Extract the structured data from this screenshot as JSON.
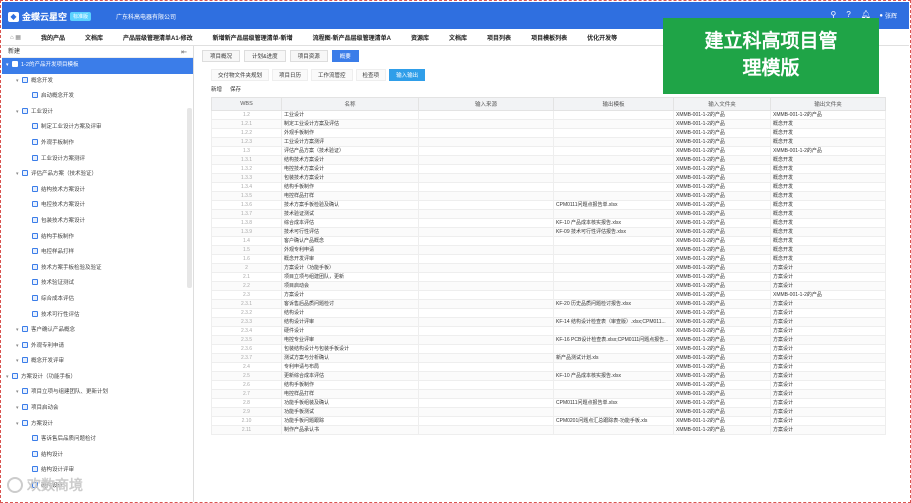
{
  "topbar": {
    "logo_text": "金蝶云星空",
    "logo_badge": "标准版",
    "company": "广东科高电器有限公司",
    "icons": [
      "search-icon",
      "help-icon",
      "bell-icon",
      "user-icon"
    ],
    "user_name": "张辉"
  },
  "menu": {
    "items": [
      "我的产品",
      "文档库",
      "产品层级管理清单A1-修改",
      "新增新产品层级管理清单-新增",
      "流程图-新产品层级管理清单A",
      "资源库",
      "文档库",
      "项目列表",
      "项目模板列表",
      "优化开发等"
    ]
  },
  "sidebar": {
    "header": "新建",
    "items": [
      {
        "label": "1-2的产品开发项目模板",
        "level": 0,
        "selected": true
      },
      {
        "label": "概念开发",
        "level": 1
      },
      {
        "label": "启动概念开发",
        "level": 2
      },
      {
        "label": "工业设计",
        "level": 1
      },
      {
        "label": "制定工业设计方案及评审",
        "level": 2
      },
      {
        "label": "外观手板制作",
        "level": 2
      },
      {
        "label": "工业设计方案测评",
        "level": 2
      },
      {
        "label": "评估产品方案（技术验证）",
        "level": 1
      },
      {
        "label": "结构技术方案设计",
        "level": 2
      },
      {
        "label": "电控技术方案设计",
        "level": 2
      },
      {
        "label": "包装技术方案设计",
        "level": 2
      },
      {
        "label": "结构手板制作",
        "level": 2
      },
      {
        "label": "电控样品打样",
        "level": 2
      },
      {
        "label": "技术方案手板检验及验证",
        "level": 2
      },
      {
        "label": "技术验证测试",
        "level": 2
      },
      {
        "label": "综合成本评估",
        "level": 2
      },
      {
        "label": "技术可行性评估",
        "level": 2
      },
      {
        "label": "客户确认产品概念",
        "level": 1
      },
      {
        "label": "外观专利申请",
        "level": 1
      },
      {
        "label": "概念开发评审",
        "level": 1
      },
      {
        "label": "方案设计（功能手板）",
        "level": 0
      },
      {
        "label": "项目立项与组建团队、更新计划",
        "level": 1
      },
      {
        "label": "项目启动会",
        "level": 1
      },
      {
        "label": "方案设计",
        "level": 1
      },
      {
        "label": "客诉售后品质问题检讨",
        "level": 2
      },
      {
        "label": "结构设计",
        "level": 2
      },
      {
        "label": "结构设计评审",
        "level": 2
      },
      {
        "label": "硬件设计",
        "level": 2
      }
    ]
  },
  "tabs": {
    "primary": [
      "项目概况",
      "计划&进度",
      "项目资源",
      "概要"
    ],
    "primary_active": 3,
    "secondary": [
      "交付物文件夹规划",
      "项目日历",
      "工作流管控",
      "检查项",
      "输入输出"
    ],
    "secondary_active": 4
  },
  "actions": [
    "新增",
    "保存"
  ],
  "grid": {
    "headers": [
      "WBS",
      "名称",
      "输入来源",
      "输出模板",
      "输入文件夹",
      "输出文件夹"
    ],
    "rows": [
      [
        "1.2",
        "工业设计",
        "",
        "",
        "XMMB-001-1-2的产品",
        "XMMB-001-1-2的产品"
      ],
      [
        "1.2.1",
        "制定工业设计方案及评估",
        "",
        "",
        "XMMB-001-1-2的产品",
        "概念开发"
      ],
      [
        "1.2.2",
        "外观手板制作",
        "",
        "",
        "XMMB-001-1-2的产品",
        "概念开发"
      ],
      [
        "1.2.3",
        "工业设计方案测评",
        "",
        "",
        "XMMB-001-1-2的产品",
        "概念开发"
      ],
      [
        "1.3",
        "评估产品方案（技术验证）",
        "",
        "",
        "XMMB-001-1-2的产品",
        "XMMB-001-1-2的产品"
      ],
      [
        "1.3.1",
        "结构技术方案设计",
        "",
        "",
        "XMMB-001-1-2的产品",
        "概念开发"
      ],
      [
        "1.3.2",
        "电控技术方案设计",
        "",
        "",
        "XMMB-001-1-2的产品",
        "概念开发"
      ],
      [
        "1.3.3",
        "包装技术方案设计",
        "",
        "",
        "XMMB-001-1-2的产品",
        "概念开发"
      ],
      [
        "1.3.4",
        "结构手板制作",
        "",
        "",
        "XMMB-001-1-2的产品",
        "概念开发"
      ],
      [
        "1.3.5",
        "电控样品打样",
        "",
        "",
        "XMMB-001-1-2的产品",
        "概念开发"
      ],
      [
        "1.3.6",
        "技术方案手板检验及确认",
        "",
        "CPM0111问题点报告单.xlsx",
        "XMMB-001-1-2的产品",
        "概念开发"
      ],
      [
        "1.3.7",
        "技术验证测试",
        "",
        "",
        "XMMB-001-1-2的产品",
        "概念开发"
      ],
      [
        "1.3.8",
        "综合成本评估",
        "",
        "KF-10 产品成本核实报告.xlsx",
        "XMMB-001-1-2的产品",
        "概念开发"
      ],
      [
        "1.3.9",
        "技术可行性评估",
        "",
        "KF-09 技术可行性评估报告.xlsx",
        "XMMB-001-1-2的产品",
        "概念开发"
      ],
      [
        "1.4",
        "客户确认产品概念",
        "",
        "",
        "XMMB-001-1-2的产品",
        "概念开发"
      ],
      [
        "1.5",
        "外观专利申请",
        "",
        "",
        "XMMB-001-1-2的产品",
        "概念开发"
      ],
      [
        "1.6",
        "概念开发评审",
        "",
        "",
        "XMMB-001-1-2的产品",
        "概念开发"
      ],
      [
        "2",
        "方案设计（功能手板）",
        "",
        "",
        "XMMB-001-1-2的产品",
        "方案设计"
      ],
      [
        "2.1",
        "项目立项与组建团队，更新",
        "",
        "",
        "XMMB-001-1-2的产品",
        "方案设计"
      ],
      [
        "2.2",
        "项目启动会",
        "",
        "",
        "XMMB-001-1-2的产品",
        "方案设计"
      ],
      [
        "2.3",
        "方案设计",
        "",
        "",
        "XMMB-001-1-2的产品",
        "XMMB-001-1-2的产品"
      ],
      [
        "2.3.1",
        "客诉售后品质问题检讨",
        "",
        "KF-20 历史品质问题检讨报告.xlsx",
        "XMMB-001-1-2的产品",
        "方案设计"
      ],
      [
        "2.3.2",
        "结构设计",
        "",
        "",
        "XMMB-001-1-2的产品",
        "方案设计"
      ],
      [
        "2.3.3",
        "结构设计评审",
        "",
        "KF-14 结构设计检查表（审查版）.xlsx;CPM011...",
        "XMMB-001-1-2的产品",
        "方案设计"
      ],
      [
        "2.3.4",
        "硬件设计",
        "",
        "",
        "XMMB-001-1-2的产品",
        "方案设计"
      ],
      [
        "2.3.5",
        "电控专业评审",
        "",
        "KF-16 PCB设计检查表.xlsx;CPM0111问题点报告...",
        "XMMB-001-1-2的产品",
        "方案设计"
      ],
      [
        "2.3.6",
        "包装结构设计与包装手板设计",
        "",
        "",
        "XMMB-001-1-2的产品",
        "方案设计"
      ],
      [
        "2.3.7",
        "测试方案与分析确认",
        "",
        "新产品测试计划.xls",
        "XMMB-001-1-2的产品",
        "方案设计"
      ],
      [
        "2.4",
        "专利申请与布局",
        "",
        "",
        "XMMB-001-1-2的产品",
        "方案设计"
      ],
      [
        "2.5",
        "更新综合成本评估",
        "",
        "KF-10 产品成本核实报告.xlsx",
        "XMMB-001-1-2的产品",
        "方案设计"
      ],
      [
        "2.6",
        "结构手板制作",
        "",
        "",
        "XMMB-001-1-2的产品",
        "方案设计"
      ],
      [
        "2.7",
        "电控样品打样",
        "",
        "",
        "XMMB-001-1-2的产品",
        "方案设计"
      ],
      [
        "2.8",
        "功能手板组装及确认",
        "",
        "CPM0111问题点报告单.xlsx",
        "XMMB-001-1-2的产品",
        "方案设计"
      ],
      [
        "2.9",
        "功能手板测试",
        "",
        "",
        "XMMB-001-1-2的产品",
        "方案设计"
      ],
      [
        "2.10",
        "功能手板问题跟踪",
        "",
        "CPM0201问题点汇总跟踪表-功能手板.xls",
        "XMMB-001-1-2的产品",
        "方案设计"
      ],
      [
        "2.11",
        "制作产品承认书",
        "",
        "",
        "XMMB-001-1-2的产品",
        "方案设计"
      ]
    ]
  },
  "banner": {
    "line1": "建立科高项目管",
    "line2": "理模版"
  },
  "watermark": "欢数商境",
  "colors": {
    "primary": "#2f6fe0",
    "selected": "#3b7de9",
    "banner": "#1fa447",
    "frame": "#d9534f"
  }
}
